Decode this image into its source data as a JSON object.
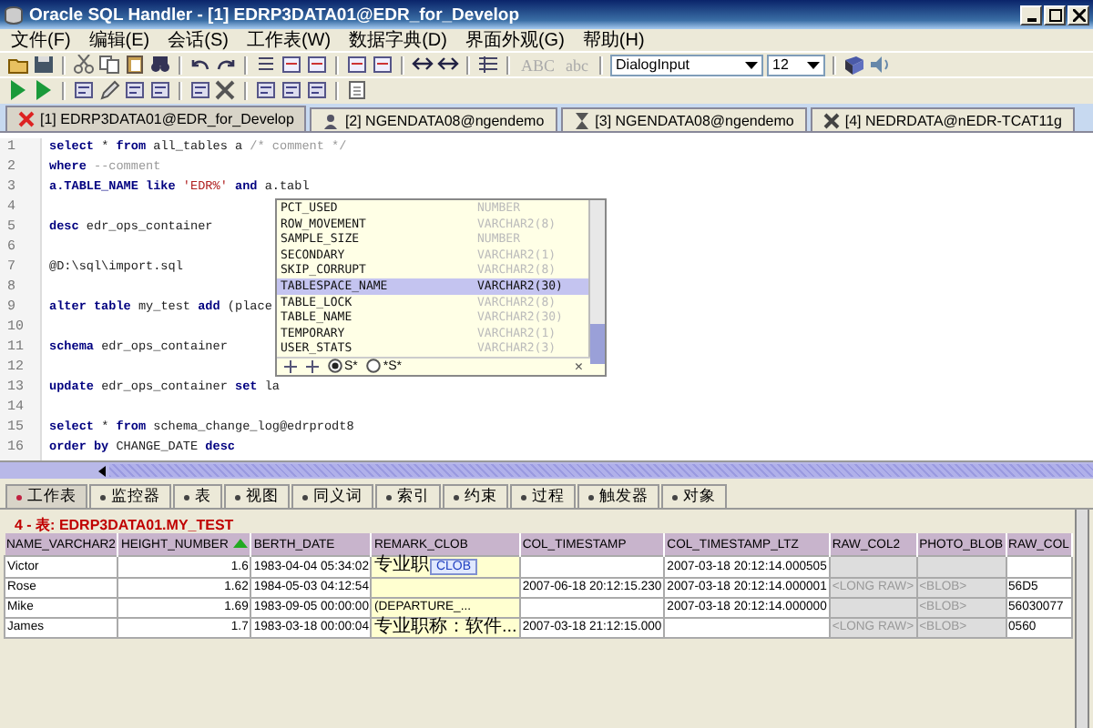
{
  "window": {
    "title": "Oracle SQL Handler - [1] EDRP3DATA01@EDR_for_Develop"
  },
  "menu": [
    "文件(F)",
    "编辑(E)",
    "会话(S)",
    "工作表(W)",
    "数据字典(D)",
    "界面外观(G)",
    "帮助(H)"
  ],
  "toolbar": {
    "text_buttons": [
      {
        "label": "ABC",
        "disabled": true
      },
      {
        "label": "abc",
        "disabled": true
      }
    ],
    "font_select": {
      "value": "DialogInput"
    },
    "size_select": {
      "value": "12"
    }
  },
  "tabs": [
    {
      "label": "[1] EDRP3DATA01@EDR_for_Develop",
      "selected": true
    },
    {
      "label": "[2] NGENDATA08@ngendemo",
      "selected": false
    },
    {
      "label": "[3] NGENDATA08@ngendemo",
      "selected": false
    },
    {
      "label": "[4] NEDRDATA@nEDR-TCAT11g",
      "selected": false
    }
  ],
  "editor": {
    "lines": [
      {
        "number": "1",
        "segments": [
          {
            "text": "select",
            "kind": "keyword"
          },
          {
            "text": " * ",
            "kind": "plain"
          },
          {
            "text": "from",
            "kind": "keyword"
          },
          {
            "text": " all_tables a ",
            "kind": "plain"
          },
          {
            "text": "/* comment */",
            "kind": "comment"
          }
        ]
      },
      {
        "number": "2",
        "segments": [
          {
            "text": "where",
            "kind": "keyword"
          },
          {
            "text": " --comment",
            "kind": "comment"
          }
        ]
      },
      {
        "number": "3",
        "segments": [
          {
            "text": "a.TABLE_NAME like",
            "kind": "keyword"
          },
          {
            "text": " 'EDR%'",
            "kind": "string"
          },
          {
            "text": " and",
            "kind": "keyword"
          },
          {
            "text": " a.tabl",
            "kind": "plain"
          }
        ]
      },
      {
        "number": "4"
      },
      {
        "number": "5",
        "segments": [
          {
            "text": "desc",
            "kind": "keyword"
          },
          {
            "text": " edr_ops_container",
            "kind": "plain"
          }
        ]
      },
      {
        "number": "6"
      },
      {
        "number": "7",
        "segments": [
          {
            "text": "@D:\\sql\\import.sql",
            "kind": "plain"
          }
        ]
      },
      {
        "number": "8"
      },
      {
        "number": "9",
        "segments": [
          {
            "text": "alter table",
            "kind": "keyword"
          },
          {
            "text": " my_test ",
            "kind": "plain"
          },
          {
            "text": "add",
            "kind": "keyword"
          },
          {
            "text": " (place",
            "kind": "plain"
          }
        ]
      },
      {
        "number": "10"
      },
      {
        "number": "11",
        "segments": [
          {
            "text": "schema",
            "kind": "keyword"
          },
          {
            "text": " edr_ops_container",
            "kind": "plain"
          }
        ]
      },
      {
        "number": "12"
      },
      {
        "number": "13",
        "segments": [
          {
            "text": "update",
            "kind": "keyword"
          },
          {
            "text": " edr_ops_container ",
            "kind": "plain"
          },
          {
            "text": "set",
            "kind": "keyword"
          },
          {
            "text": " la",
            "kind": "plain"
          }
        ]
      },
      {
        "number": "14"
      },
      {
        "number": "15",
        "segments": [
          {
            "text": "select",
            "kind": "keyword"
          },
          {
            "text": " * ",
            "kind": "plain"
          },
          {
            "text": "from",
            "kind": "keyword"
          },
          {
            "text": " schema_change_log@edrprodt8",
            "kind": "plain"
          }
        ]
      },
      {
        "number": "16",
        "segments": [
          {
            "text": "order by",
            "kind": "keyword"
          },
          {
            "text": " CHANGE_DATE ",
            "kind": "plain"
          },
          {
            "text": "desc",
            "kind": "keyword"
          }
        ]
      }
    ]
  },
  "autocomplete": {
    "items": [
      {
        "name": "PCT_USED",
        "type": "NUMBER",
        "selected": false
      },
      {
        "name": "ROW_MOVEMENT",
        "type": "VARCHAR2(8)",
        "selected": false
      },
      {
        "name": "SAMPLE_SIZE",
        "type": "NUMBER",
        "selected": false
      },
      {
        "name": "SECONDARY",
        "type": "VARCHAR2(1)",
        "selected": false
      },
      {
        "name": "SKIP_CORRUPT",
        "type": "VARCHAR2(8)",
        "selected": false
      },
      {
        "name": "TABLESPACE_NAME",
        "type": "VARCHAR2(30)",
        "selected": true
      },
      {
        "name": "TABLE_LOCK",
        "type": "VARCHAR2(8)",
        "selected": false
      },
      {
        "name": "TABLE_NAME",
        "type": "VARCHAR2(30)",
        "selected": false
      },
      {
        "name": "TEMPORARY",
        "type": "VARCHAR2(1)",
        "selected": false
      },
      {
        "name": "USER_STATS",
        "type": "VARCHAR2(3)",
        "selected": false
      }
    ],
    "options": [
      {
        "label": "S*",
        "selected": true
      },
      {
        "label": "*S*",
        "selected": false
      }
    ],
    "close": "×"
  },
  "bottom_tabs": [
    {
      "label": "工作表",
      "selected": true
    },
    {
      "label": "监控器",
      "selected": false
    },
    {
      "label": "表",
      "selected": false
    },
    {
      "label": "视图",
      "selected": false
    },
    {
      "label": "同义词",
      "selected": false
    },
    {
      "label": "索引",
      "selected": false
    },
    {
      "label": "约束",
      "selected": false
    },
    {
      "label": "过程",
      "selected": false
    },
    {
      "label": "触发器",
      "selected": false
    },
    {
      "label": "对象",
      "selected": false
    }
  ],
  "result": {
    "title": "4 - 表: EDRP3DATA01.MY_TEST",
    "columns": [
      {
        "label": "NAME_VARCHAR2",
        "sorted": false
      },
      {
        "label": "HEIGHT_NUMBER",
        "sorted": true
      },
      {
        "label": "BERTH_DATE",
        "sorted": false
      },
      {
        "label": "REMARK_CLOB",
        "sorted": false
      },
      {
        "label": "COL_TIMESTAMP",
        "sorted": false
      },
      {
        "label": "COL_TIMESTAMP_LTZ",
        "sorted": false
      },
      {
        "label": "RAW_COL2",
        "sorted": false
      },
      {
        "label": "PHOTO_BLOB",
        "sorted": false
      },
      {
        "label": "RAW_COL",
        "sorted": false
      }
    ],
    "rows": [
      [
        "Victor",
        "1.6",
        "1983-04-04 05:34:02",
        "专业职",
        "",
        "2007-03-18 20:12:14.000505",
        "",
        "",
        ""
      ],
      [
        "Rose",
        "1.62",
        "1984-05-03 04:12:54",
        "",
        "2007-06-18 20:12:15.230",
        "2007-03-18 20:12:14.000001",
        "<LONG RAW>",
        "<BLOB>",
        "56D5"
      ],
      [
        "Mike",
        "1.69",
        "1983-09-05 00:00:00",
        "(DEPARTURE_...",
        "",
        "2007-03-18 20:12:14.000000",
        "",
        "<BLOB>",
        "56030077"
      ],
      [
        "James",
        "1.7",
        "1983-03-18 00:00:04",
        "专业职称：软件...",
        "2007-03-18 21:12:15.000",
        "",
        "<LONG RAW>",
        "<BLOB>",
        "0560"
      ]
    ],
    "tooltip": {
      "text": "CLOB"
    }
  }
}
